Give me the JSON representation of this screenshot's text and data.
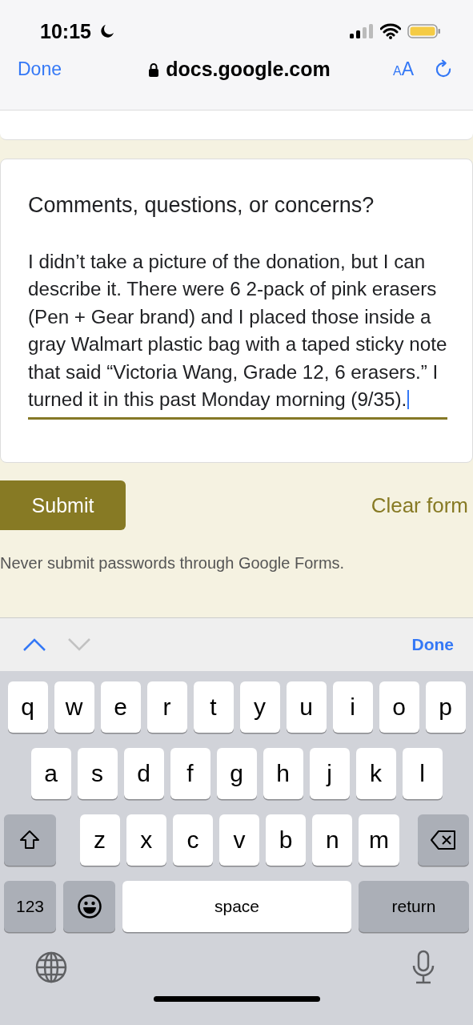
{
  "status_bar": {
    "time": "10:15",
    "do_not_disturb": true
  },
  "browser_bar": {
    "done": "Done",
    "url": "docs.google.com",
    "secure": true,
    "text_size": {
      "small": "A",
      "large": "A"
    }
  },
  "question": {
    "title": "Comments, questions, or concerns?",
    "answer": "I didn’t take a picture of the donation, but I can describe it. There were 6 2-pack of pink erasers (Pen + Gear brand) and I placed those inside a gray Walmart plastic bag with a taped sticky note that said “Victoria Wang, Grade 12, 6 erasers.” I turned it in this past Monday morning (9/35).",
    "focused": true
  },
  "actions": {
    "submit": "Submit",
    "clear": "Clear form"
  },
  "disclaimer": "Never submit passwords through Google Forms.",
  "keyboard_toolbar": {
    "previous_disabled": false,
    "next_disabled": true,
    "done": "Done"
  },
  "keyboard": {
    "rows": [
      [
        {
          "kind": "letter",
          "label": "q"
        },
        {
          "kind": "letter",
          "label": "w"
        },
        {
          "kind": "letter",
          "label": "e"
        },
        {
          "kind": "letter",
          "label": "r"
        },
        {
          "kind": "letter",
          "label": "t"
        },
        {
          "kind": "letter",
          "label": "y"
        },
        {
          "kind": "letter",
          "label": "u"
        },
        {
          "kind": "letter",
          "label": "i"
        },
        {
          "kind": "letter",
          "label": "o"
        },
        {
          "kind": "letter",
          "label": "p"
        }
      ],
      [
        {
          "kind": "letter",
          "label": "a"
        },
        {
          "kind": "letter",
          "label": "s"
        },
        {
          "kind": "letter",
          "label": "d"
        },
        {
          "kind": "letter",
          "label": "f"
        },
        {
          "kind": "letter",
          "label": "g"
        },
        {
          "kind": "letter",
          "label": "h"
        },
        {
          "kind": "letter",
          "label": "j"
        },
        {
          "kind": "letter",
          "label": "k"
        },
        {
          "kind": "letter",
          "label": "l"
        }
      ],
      [
        {
          "kind": "shift"
        },
        {
          "kind": "letter",
          "label": "z"
        },
        {
          "kind": "letter",
          "label": "x"
        },
        {
          "kind": "letter",
          "label": "c"
        },
        {
          "kind": "letter",
          "label": "v"
        },
        {
          "kind": "letter",
          "label": "b"
        },
        {
          "kind": "letter",
          "label": "n"
        },
        {
          "kind": "letter",
          "label": "m"
        },
        {
          "kind": "delete"
        }
      ]
    ],
    "bottom_keys": [
      {
        "kind": "numbers",
        "label": "123"
      },
      {
        "kind": "emoji"
      },
      {
        "kind": "space",
        "label": "space"
      },
      {
        "kind": "return",
        "label": "return"
      }
    ]
  }
}
